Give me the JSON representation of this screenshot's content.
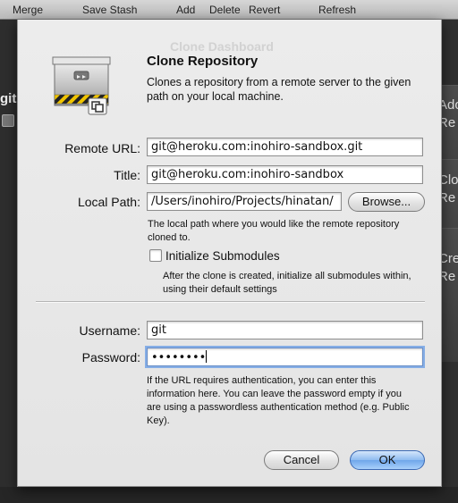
{
  "toolbar": {
    "items": [
      "Merge",
      "Save Stash",
      "Add",
      "Delete",
      "Revert",
      "Refresh"
    ]
  },
  "background": {
    "repo_label": "git",
    "right_labels": [
      "Ado",
      "Re",
      "Clo",
      "Re",
      "Cre",
      "Re"
    ]
  },
  "dialog": {
    "ghost_title": "Clone Dashboard",
    "title": "Clone Repository",
    "description": "Clones a repository from a remote server to the given path on your local machine.",
    "remote_url": {
      "label": "Remote URL:",
      "value": "git@heroku.com:inohiro-sandbox.git"
    },
    "title_field": {
      "label": "Title:",
      "value": "git@heroku.com:inohiro-sandbox"
    },
    "local_path": {
      "label": "Local Path:",
      "value": "/Users/inohiro/Projects/hinatan/",
      "help": "The local path where you would like the remote repository cloned to."
    },
    "browse_label": "Browse...",
    "init_submodules": {
      "label": "Initialize Submodules",
      "checked": false,
      "help": "After the clone is created, initialize all submodules within, using their default settings"
    },
    "username": {
      "label": "Username:",
      "value": "git"
    },
    "password": {
      "label": "Password:",
      "value": "••••••••"
    },
    "auth_help": "If the URL requires authentication, you can enter this information here. You can leave the password empty if you are using a passwordless authentication method (e.g. Public Key).",
    "cancel_label": "Cancel",
    "ok_label": "OK"
  }
}
